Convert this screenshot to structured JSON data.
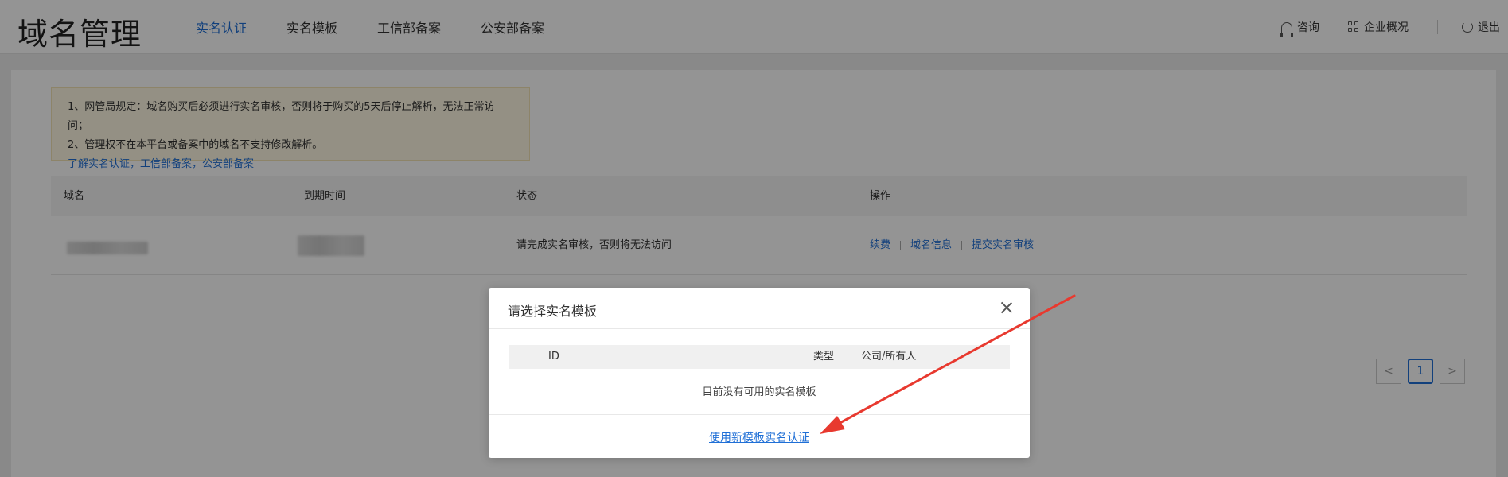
{
  "header": {
    "brand": "域名管理",
    "nav": [
      {
        "label": "实名认证",
        "active": true
      },
      {
        "label": "实名模板",
        "active": false
      },
      {
        "label": "工信部备案",
        "active": false
      },
      {
        "label": "公安部备案",
        "active": false
      }
    ],
    "right": {
      "consult": "咨询",
      "overview": "企业概况",
      "logout": "退出"
    }
  },
  "notice": {
    "line1": "1、网管局规定：域名购买后必须进行实名审核，否则将于购买的5天后停止解析，无法正常访问；",
    "line2": "2、管理权不在本平台或备案中的域名不支持修改解析。",
    "link": "了解实名认证，工信部备案，公安部备案"
  },
  "table": {
    "columns": [
      "域名",
      "到期时间",
      "状态",
      "操作"
    ],
    "rows": [
      {
        "domain": "",
        "expire": "",
        "status": "请完成实名审核，否则将无法访问",
        "actions": [
          "续费",
          "域名信息",
          "提交实名审核"
        ]
      }
    ]
  },
  "pagination": {
    "prev": "<",
    "current": "1",
    "next": ">"
  },
  "modal": {
    "title": "请选择实名模板",
    "columns": [
      "ID",
      "类型",
      "公司/所有人"
    ],
    "empty": "目前没有可用的实名模板",
    "footer_link": "使用新模板实名认证"
  },
  "colors": {
    "accent": "#1f6fd6",
    "arrow": "#e8392f",
    "notice_bg": "#fff8e3"
  }
}
